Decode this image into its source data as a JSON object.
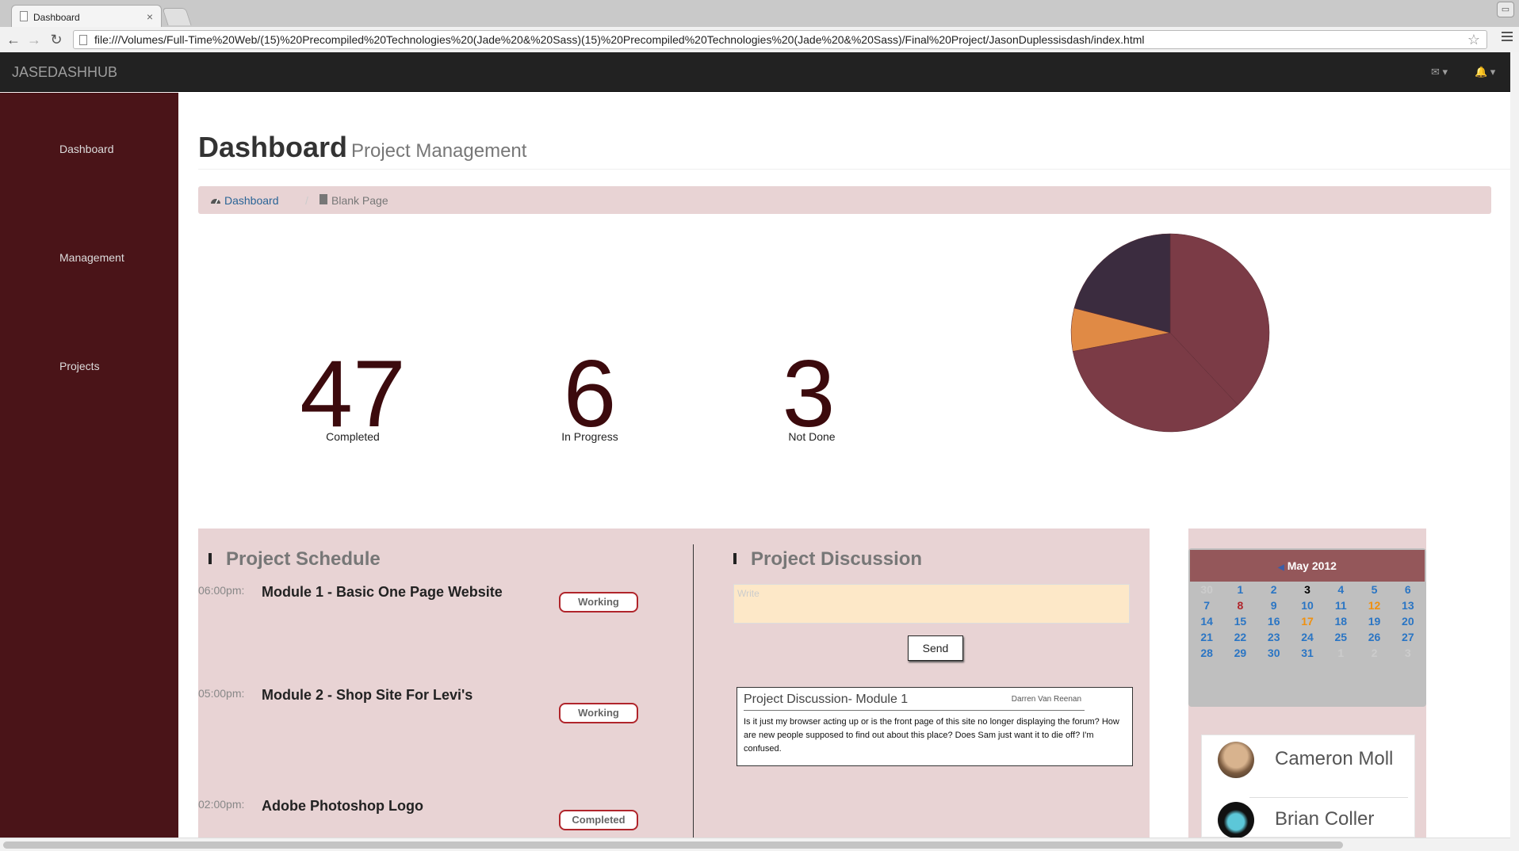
{
  "browser": {
    "tab_title": "Dashboard",
    "tab_close": "×",
    "url": "file:///Volumes/Full-Time%20Web/(15)%20Precompiled%20Technologies%20(Jade%20&%20Sass)(15)%20Precompiled%20Technologies%20(Jade%20&%20Sass)/Final%20Project/JasonDuplessisdash/index.html",
    "back": "←",
    "forward": "→",
    "reload": "↻",
    "star": "☆"
  },
  "navbar": {
    "brand": "JASEDASHHUB",
    "mail_icon": "✉ ▾",
    "bell_icon": "🔔 ▾"
  },
  "sidebar": {
    "items": [
      {
        "label": "Dashboard"
      },
      {
        "label": "Management"
      },
      {
        "label": "Projects"
      }
    ]
  },
  "header": {
    "title": "Dashboard",
    "subtitle": "Project Management"
  },
  "breadcrumb": {
    "link": "Dashboard",
    "separator": "/",
    "current": "Blank Page"
  },
  "stats": [
    {
      "value": "47",
      "label": "Completed"
    },
    {
      "value": "6",
      "label": "In Progress"
    },
    {
      "value": "3",
      "label": "Not Done"
    }
  ],
  "chart_data": {
    "type": "pie",
    "values": [
      38,
      34,
      7,
      21
    ],
    "colors": [
      "#7b3b46",
      "#7b3b46",
      "#e08a45",
      "#3b2c3f"
    ]
  },
  "schedule": {
    "title": "Project Schedule",
    "items": [
      {
        "time": "06:00pm:",
        "module": "Module 1 - Basic One Page Website",
        "status": "Working"
      },
      {
        "time": "05:00pm:",
        "module": "Module 2 - Shop Site For Levi's",
        "status": "Working"
      },
      {
        "time": "02:00pm:",
        "module": "Adobe Photoshop Logo",
        "status": "Completed"
      }
    ]
  },
  "discussion": {
    "title": "Project Discussion",
    "write_placeholder": "Write",
    "send_label": "Send",
    "post_title": "Project Discussion- Module 1",
    "post_author": "Darren Van Reenan",
    "post_text": "Is it just my browser acting up or is the front page of this site no longer displaying the forum? How are new people supposed to find out about this place? Does Sam just want it to die off? I'm confused."
  },
  "calendar": {
    "month": "May 2012",
    "rows": [
      [
        "30",
        "1",
        "2",
        "3",
        "4",
        "5",
        "6"
      ],
      [
        "7",
        "8",
        "9",
        "10",
        "11",
        "12",
        "13"
      ],
      [
        "14",
        "15",
        "16",
        "17",
        "18",
        "19",
        "20"
      ],
      [
        "21",
        "22",
        "23",
        "24",
        "25",
        "26",
        "27"
      ],
      [
        "28",
        "29",
        "30",
        "31",
        "1",
        "2",
        "3"
      ]
    ]
  },
  "contacts": [
    {
      "name": "Cameron Moll"
    },
    {
      "name": "Brian Coller"
    }
  ]
}
